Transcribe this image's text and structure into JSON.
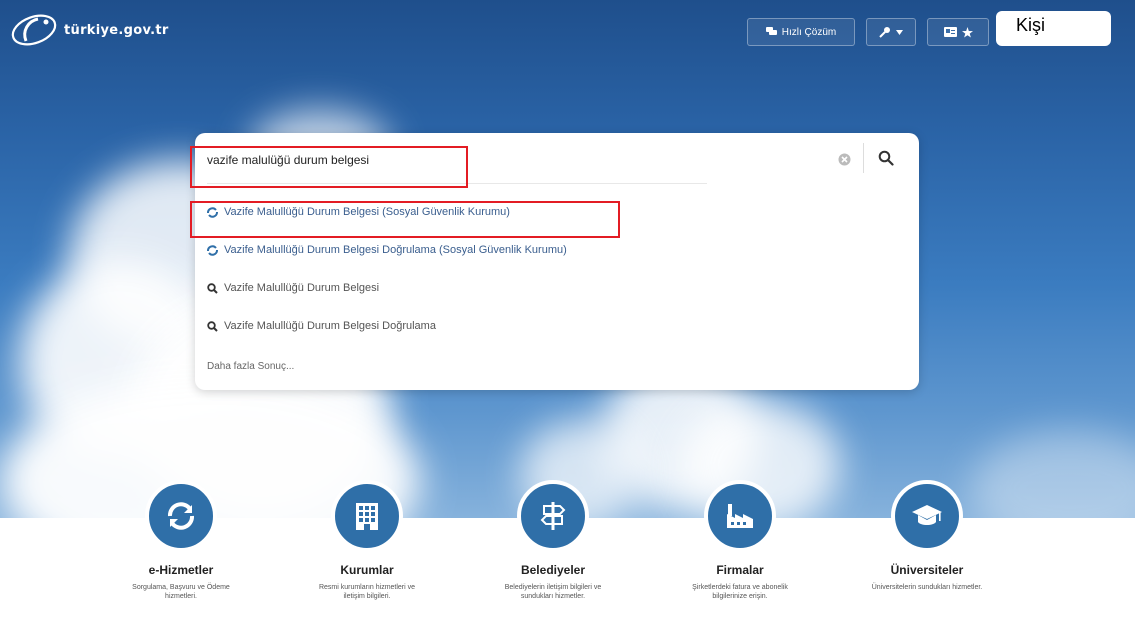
{
  "header": {
    "logo_text": "türkiye.gov.tr",
    "quick_solution": "Hızlı Çözüm",
    "user_box": "Kişi"
  },
  "search": {
    "query": "vazife malulüğü durum belgesi",
    "suggestions": [
      {
        "text": "Vazife Malullüğü Durum Belgesi (Sosyal Güvenlik Kurumu)",
        "icon": "service-icon"
      },
      {
        "text": "Vazife Malullüğü Durum Belgesi Doğrulama (Sosyal Güvenlik Kurumu)",
        "icon": "service-icon"
      },
      {
        "text": "Vazife Malullüğü Durum Belgesi",
        "icon": "search-icon"
      },
      {
        "text": "Vazife Malullüğü Durum Belgesi Doğrulama",
        "icon": "search-icon"
      }
    ],
    "more": "Daha fazla Sonuç..."
  },
  "categories": [
    {
      "title": "e-Hizmetler",
      "desc": "Sorgulama, Başvuru ve Ödeme hizmetleri.",
      "icon": "refresh-icon"
    },
    {
      "title": "Kurumlar",
      "desc": "Resmi kurumların hizmetleri ve iletişim bilgileri.",
      "icon": "building-icon"
    },
    {
      "title": "Belediyeler",
      "desc": "Belediyelerin iletişim bilgileri ve sundukları hizmetler.",
      "icon": "signpost-icon"
    },
    {
      "title": "Firmalar",
      "desc": "Şirketlerdeki fatura ve abonelik bilgilerinize erişin.",
      "icon": "factory-icon"
    },
    {
      "title": "Üniversiteler",
      "desc": "Üniversitelerin sundukları hizmetler.",
      "icon": "graduation-cap-icon"
    }
  ],
  "colors": {
    "accent": "#2f6fa8",
    "highlight_box": "#e31c24",
    "hero_blue": "#2a63a6"
  }
}
